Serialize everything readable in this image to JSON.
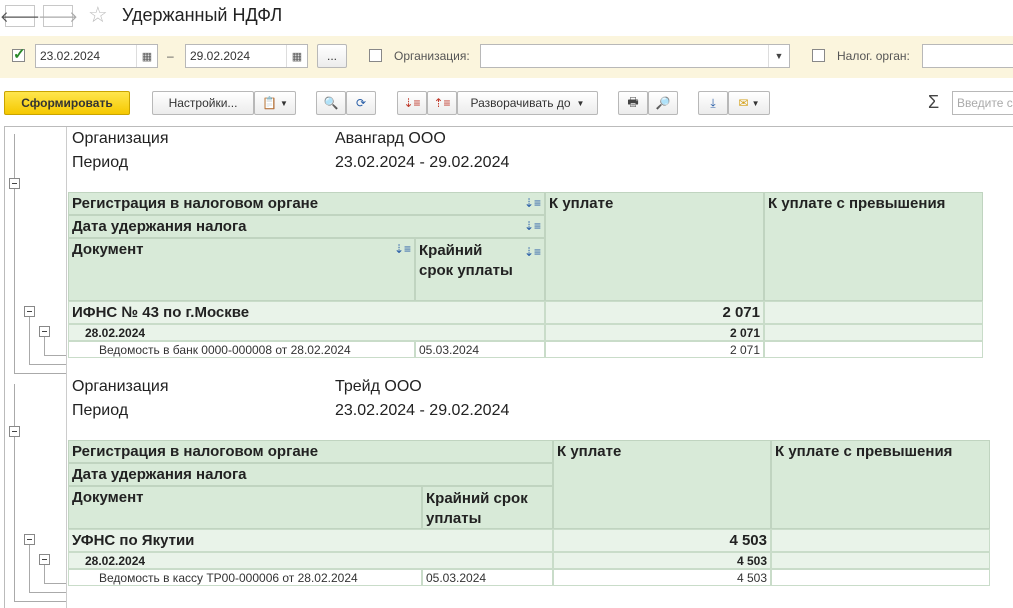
{
  "window": {
    "title": "Удержанный НДФЛ"
  },
  "filters": {
    "date_from": "23.02.2024",
    "date_to": "29.02.2024",
    "dash": "–",
    "more_label": "...",
    "org_label": "Организация:",
    "org_value": "",
    "tax_label": "Налог. орган:",
    "tax_value": ""
  },
  "toolbar": {
    "generate_label": "Сформировать",
    "settings_label": "Настройки...",
    "expand_label": "Разворачивать до",
    "sigma": "Σ",
    "search_placeholder": "Введите с"
  },
  "report": {
    "header": {
      "col_reg": "Регистрация в налоговом органе",
      "col_date": "Дата удержания налога",
      "col_doc": "Документ",
      "col_deadline": "Крайний срок уплаты",
      "col_pay": "К уплате",
      "col_over": "К уплате с превышения"
    },
    "sections": [
      {
        "org_label": "Организация",
        "org_value": "Авангард ООО",
        "period_label": "Период",
        "period_value": "23.02.2024 - 29.02.2024",
        "group": "ИФНС № 43 по г.Москве",
        "group_total": "2 071",
        "date": "28.02.2024",
        "date_total": "2 071",
        "doc": "Ведомость в банк 0000-000008 от 28.02.2024",
        "deadline": "05.03.2024",
        "amount": "2 071"
      },
      {
        "org_label": "Организация",
        "org_value": "Трейд ООО",
        "period_label": "Период",
        "period_value": "23.02.2024 - 29.02.2024",
        "group": "УФНС по Якутии",
        "group_total": "4 503",
        "date": "28.02.2024",
        "date_total": "4 503",
        "doc": "Ведомость в кассу ТР00-000006 от 28.02.2024",
        "deadline": "05.03.2024",
        "amount": "4 503"
      }
    ]
  }
}
